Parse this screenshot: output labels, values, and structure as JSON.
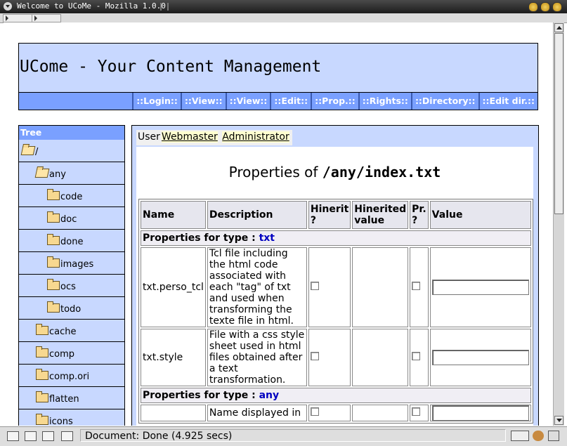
{
  "window": {
    "title": "Welcome to UCoMe - Mozilla 1.0.0"
  },
  "header": {
    "site_title": "UCome - Your Content Management"
  },
  "menu": [
    "::Login::",
    "::View::",
    "::View::",
    "::Edit::",
    "::Prop.::",
    "::Rights::",
    "::Directory::",
    "::Edit dir.::"
  ],
  "tree": {
    "title": "Tree",
    "items": [
      {
        "label": "/",
        "icon": "open-folder-icon"
      },
      {
        "label": "any",
        "icon": "open-folder-icon"
      },
      {
        "label": "code",
        "icon": "folder-icon"
      },
      {
        "label": "doc",
        "icon": "folder-icon"
      },
      {
        "label": "done",
        "icon": "folder-icon"
      },
      {
        "label": "images",
        "icon": "folder-icon"
      },
      {
        "label": "ocs",
        "icon": "folder-icon"
      },
      {
        "label": "todo",
        "icon": "folder-icon"
      },
      {
        "label": "cache",
        "icon": "folder-icon"
      },
      {
        "label": "comp",
        "icon": "folder-icon"
      },
      {
        "label": "comp.ori",
        "icon": "folder-icon"
      },
      {
        "label": "flatten",
        "icon": "folder-icon"
      },
      {
        "label": "icons",
        "icon": "folder-icon"
      }
    ]
  },
  "main": {
    "tabs": {
      "user": "User",
      "webmaster": "Webmaster",
      "administrator": "Administrator"
    },
    "heading_prefix": "Properties of ",
    "heading_path": "/any/index.txt",
    "columns": {
      "name": "Name",
      "description": "Description",
      "hinerit": "Hinerit ?",
      "hinerited": "Hinerited value",
      "pr": "Pr. ?",
      "value": "Value"
    },
    "type_prefix": "Properties for type : ",
    "groups": [
      {
        "type": "txt",
        "rows": [
          {
            "name": "txt.perso_tcl",
            "description": "Tcl file including the html code associated with each \"tag\" of txt and used when transforming the texte file in html.",
            "value": ""
          },
          {
            "name": "txt.style",
            "description": "File with a css style sheet used in html files obtained after a text transformation.",
            "value": ""
          }
        ]
      },
      {
        "type": "any",
        "rows": [
          {
            "name": "",
            "description": "Name displayed in",
            "value": ""
          }
        ]
      }
    ]
  },
  "status": {
    "text": "Document: Done (4.925 secs)"
  }
}
